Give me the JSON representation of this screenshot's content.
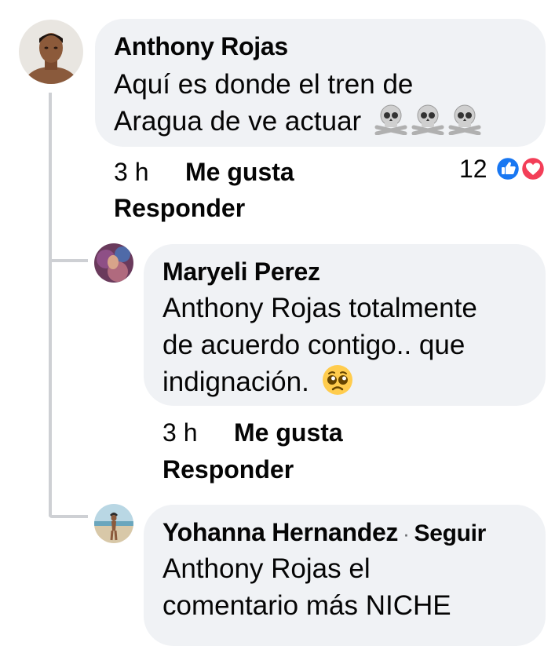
{
  "comments": [
    {
      "author": "Anthony Rojas",
      "lines": [
        "Aquí es donde el tren de",
        "Aragua de ve actuar"
      ],
      "emoji": "skull-and-crossbones x3",
      "time": "3 h",
      "like_label": "Me gusta",
      "reply_label": "Responder",
      "reaction_count": "12",
      "reactions": [
        "like",
        "love"
      ]
    },
    {
      "author": "Maryeli Perez",
      "lines": [
        "Anthony Rojas totalmente",
        "de acuerdo contigo.. que",
        "indignación."
      ],
      "emoji": "pleading-face",
      "time": "3 h",
      "like_label": "Me gusta",
      "reply_label": "Responder"
    },
    {
      "author": "Yohanna Hernandez",
      "separator": "·",
      "follow_label": "Seguir",
      "lines": [
        "Anthony Rojas el",
        "comentario más NICHE"
      ]
    }
  ],
  "colors": {
    "bubble": "#f0f2f5",
    "thread_line": "#ced0d4",
    "like_blue": "#1877f2",
    "love_red": "#f33e58",
    "text": "#050505"
  }
}
